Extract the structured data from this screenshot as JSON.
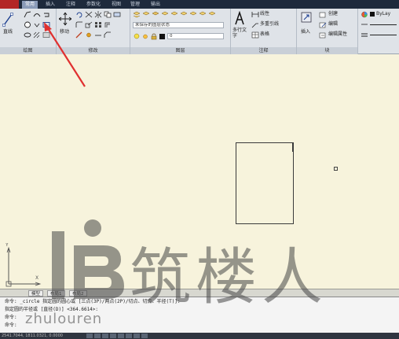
{
  "tabs": [
    "常用",
    "插入",
    "注释",
    "参数化",
    "视图",
    "管理",
    "输出"
  ],
  "ribbon": {
    "draw_panel_title": "绘图",
    "modify_panel_title": "修改",
    "layers_panel_title": "图层",
    "annotation_panel_title": "注释",
    "block_panel_title": "块",
    "line_label": "直线",
    "move_label": "移动",
    "layer_state_combo": "未保存的图层状态",
    "layer_combo": "0",
    "multiline_text_label": "多行文字",
    "linear_label": "线性",
    "multileader_label": "多重引线",
    "table_label": "表格",
    "insert_label": "插入",
    "create_label": "创建",
    "edit_label": "编辑",
    "edit_attr_label": "编辑属性",
    "bylayer_label": "ByLay"
  },
  "layout_tabs": [
    "模型",
    "布局1",
    "布局2"
  ],
  "command": {
    "line1": "命令: _circle 指定圆的圆心或 [三点(3P)/两点(2P)/切点、切点、半径(T)]:",
    "line2": "指定圆的半径或 [直径(D)] <364.6614>:",
    "line3": "命令:",
    "line4": "命令:"
  },
  "status": {
    "coords": "2541.7044, 1811.0321, 0.0000"
  },
  "watermark": {
    "text": "筑楼人",
    "sub": "zhulouren"
  },
  "colors": {
    "canvas": "#f7f3dc",
    "ribbon": "#dfe3e8",
    "app_button": "#b32626",
    "arrow": "#e03030"
  }
}
